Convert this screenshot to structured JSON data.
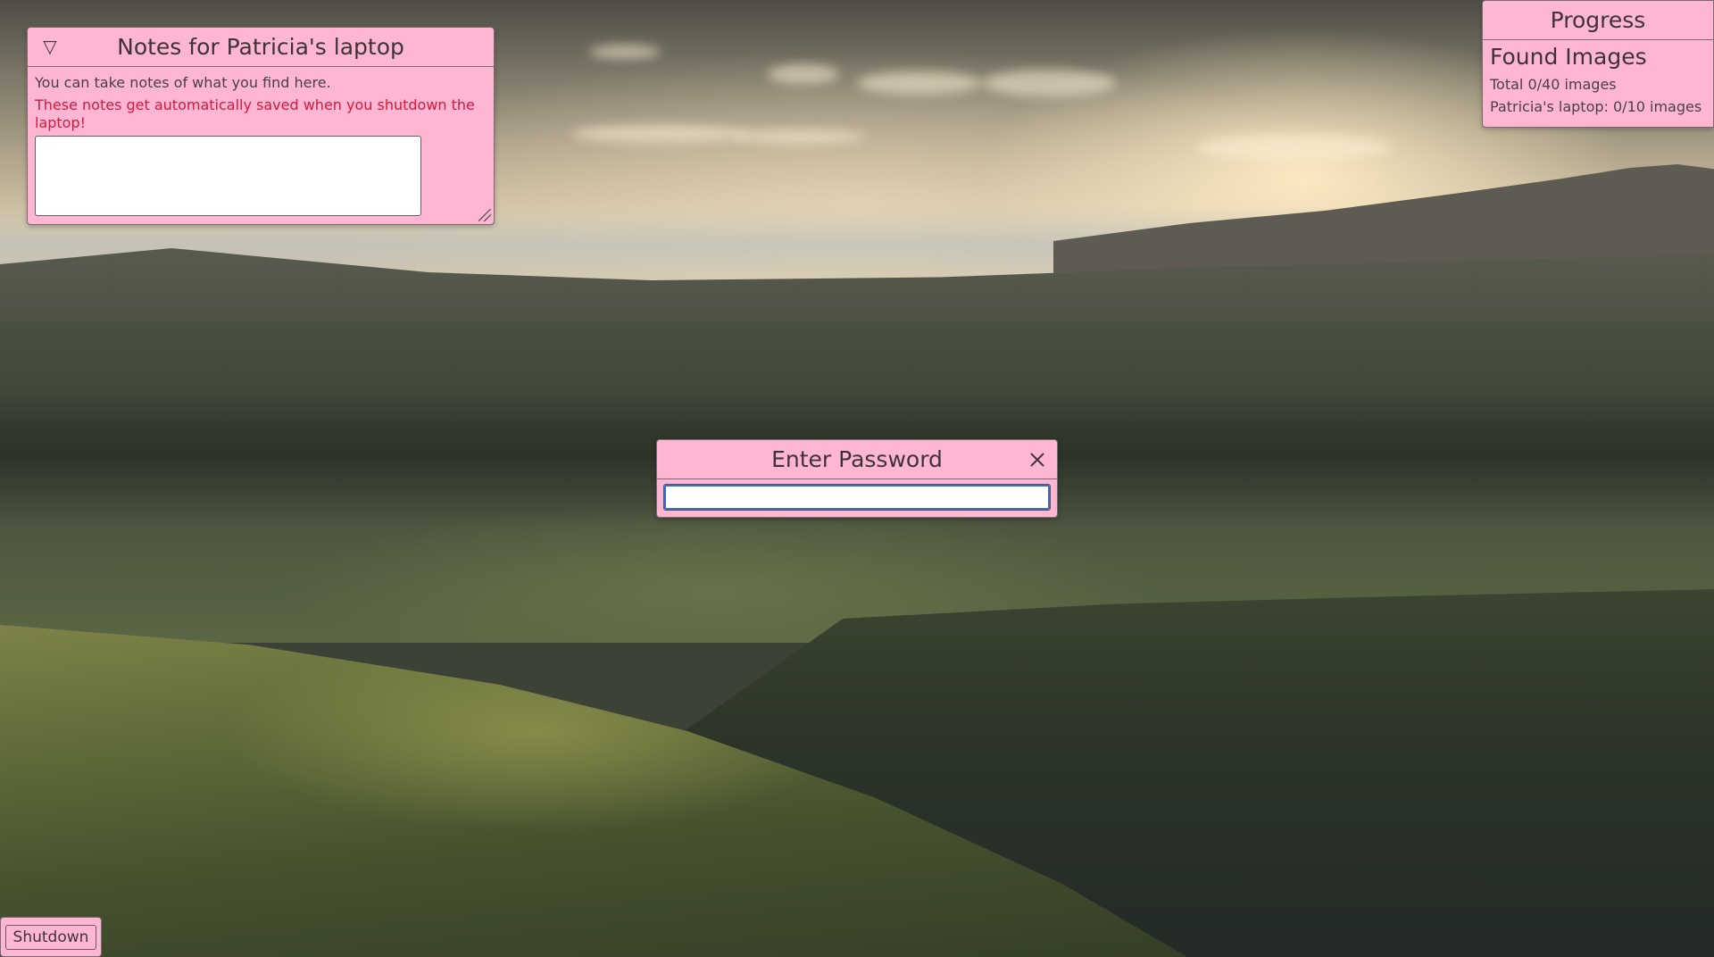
{
  "notes": {
    "title": "Notes for Patricia's laptop",
    "collapse_icon": "▽",
    "hint": "You can take notes of what you find here.",
    "warning": "These notes get automatically saved when you shutdown the laptop!",
    "text_value": "",
    "warning_color": "#d01a3e"
  },
  "progress": {
    "title": "Progress",
    "heading": "Found Images",
    "total": "Total 0/40 images",
    "device": "Patricia's laptop: 0/10 images"
  },
  "password_dialog": {
    "title": "Enter Password",
    "input_value": ""
  },
  "taskbar": {
    "shutdown_label": "Shutdown"
  },
  "theme": {
    "panel_bg": "#ffb6d3",
    "panel_border": "#7a6a72"
  }
}
